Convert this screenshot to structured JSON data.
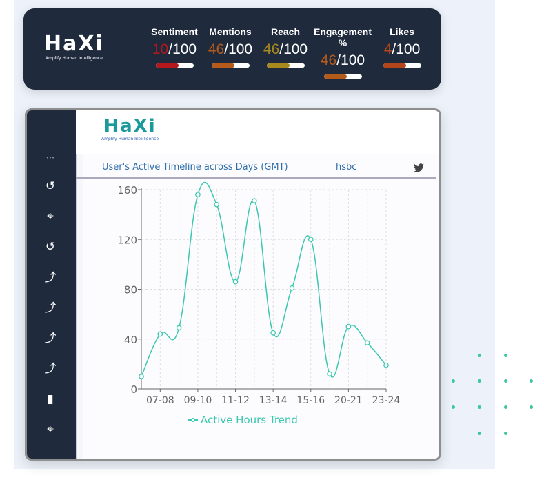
{
  "brand": {
    "name": "HaXi",
    "tagline": "Amplify Human Intelligence"
  },
  "metrics": [
    {
      "label": "Sentiment",
      "value": "10",
      "max": "/100",
      "color": "#b3191c",
      "fill": 0.6
    },
    {
      "label": "Mentions",
      "value": "46",
      "max": "/100",
      "color": "#b45a1a",
      "fill": 0.6
    },
    {
      "label": "Reach",
      "value": "46",
      "max": "/100",
      "color": "#a8891e",
      "fill": 0.6
    },
    {
      "label": "Engagement %",
      "value": "46",
      "max": "/100",
      "color": "#b45a1a",
      "fill": 0.6
    },
    {
      "label": "Likes",
      "value": "4",
      "max": "/100",
      "color": "#b4451a",
      "fill": 0.6
    }
  ],
  "sidebar": {
    "icons": [
      "more-icon",
      "history-icon",
      "crosshair-icon",
      "history-icon",
      "trend-sparkle-icon",
      "trend-sparkle-icon",
      "trend-sparkle-icon",
      "trend-sparkle-icon",
      "bar-chart-icon",
      "crosshair-icon"
    ]
  },
  "panel": {
    "title": "User's Active Timeline across Days (GMT)",
    "keyword": "hsbc",
    "icon": "twitter-icon"
  },
  "chart_data": {
    "type": "line",
    "categories": [
      "",
      "07-08",
      "",
      "09-10",
      "",
      "11-12",
      "",
      "13-14",
      "",
      "15-16",
      "",
      "20-21",
      "",
      "23-24"
    ],
    "series": [
      {
        "name": "Active Hours Trend",
        "values": [
          10,
          44,
          49,
          156,
          148,
          86,
          151,
          45,
          81,
          120,
          12,
          50,
          37,
          19
        ]
      }
    ],
    "ylim": [
      0,
      160
    ],
    "yticks": [
      0,
      40,
      80,
      120,
      160
    ],
    "grid": true,
    "legend": "bottom",
    "color": "#3cc7b0",
    "smooth": true
  }
}
